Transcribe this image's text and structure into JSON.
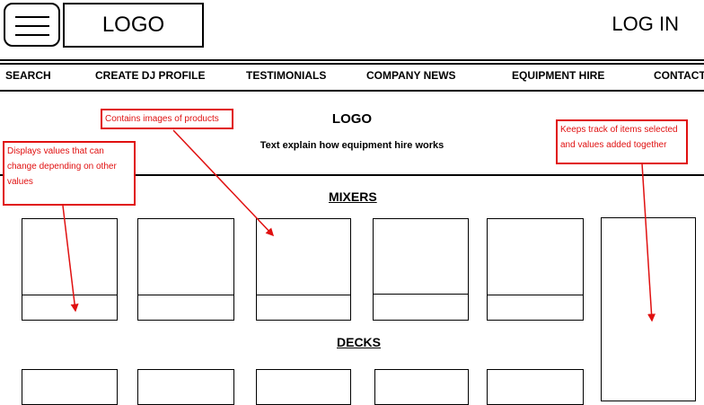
{
  "header": {
    "logo": "LOGO",
    "login": "LOG IN",
    "menu_icon": "hamburger-icon"
  },
  "nav": [
    "SEARCH",
    "CREATE DJ PROFILE",
    "TESTIMONIALS",
    "COMPANY NEWS",
    "EQUIPMENT HIRE",
    "CONTACT"
  ],
  "intro": {
    "logo": "LOGO",
    "text": "Text explain how equipment hire works"
  },
  "sections": {
    "mixers": "MIXERS",
    "decks": "DECKS"
  },
  "annotations": {
    "values": "Displays values that can change depending on other values",
    "images": "Contains images of products",
    "tracker": "Keeps track of items selected and values added together"
  },
  "colors": {
    "annotation": "#e01010"
  }
}
